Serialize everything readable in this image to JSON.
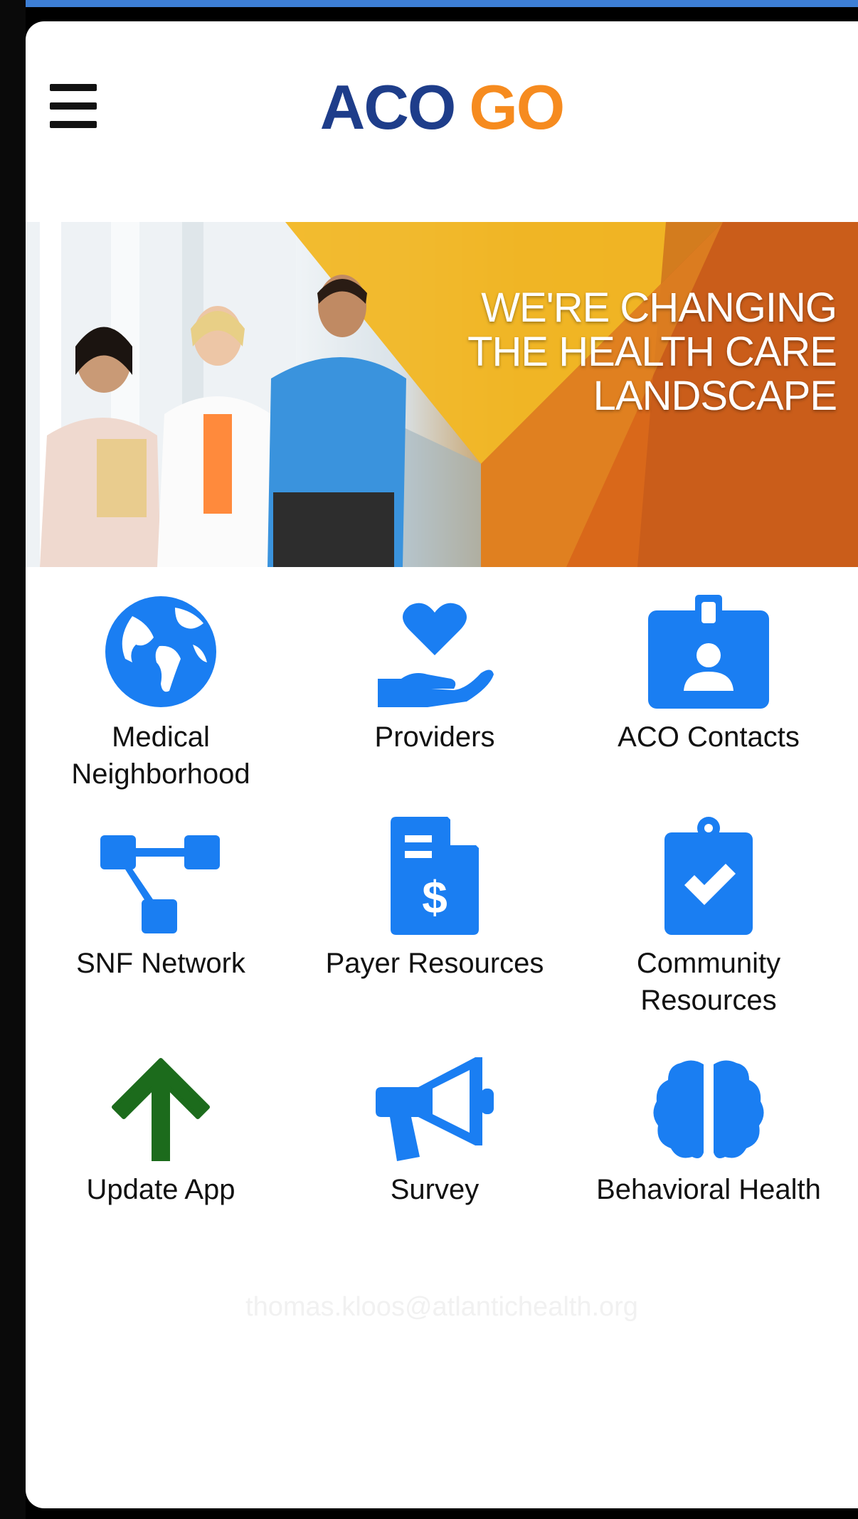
{
  "app": {
    "logo_part1": "ACO",
    "logo_part2": "GO"
  },
  "banner": {
    "line1": "WE'RE CHANGING",
    "line2": "THE HEALTH CARE",
    "line3": "LANDSCAPE"
  },
  "tiles": [
    {
      "label": "Medical Neighborhood",
      "icon": "globe-icon"
    },
    {
      "label": "Providers",
      "icon": "heart-hand-icon"
    },
    {
      "label": "ACO Contacts",
      "icon": "id-badge-icon"
    },
    {
      "label": "SNF Network",
      "icon": "network-icon"
    },
    {
      "label": "Payer Resources",
      "icon": "invoice-dollar-icon"
    },
    {
      "label": "Community Resources",
      "icon": "clipboard-check-icon"
    },
    {
      "label": "Update App",
      "icon": "arrow-up-icon"
    },
    {
      "label": "Survey",
      "icon": "megaphone-icon"
    },
    {
      "label": "Behavioral Health",
      "icon": "brain-icon"
    }
  ],
  "user": {
    "email": "thomas.kloos@atlantichealth.org"
  },
  "colors": {
    "icon_blue": "#1a7ef2",
    "update_green": "#1c6b1c",
    "logo_navy": "#1e3d8a",
    "logo_orange": "#f68b1f"
  }
}
